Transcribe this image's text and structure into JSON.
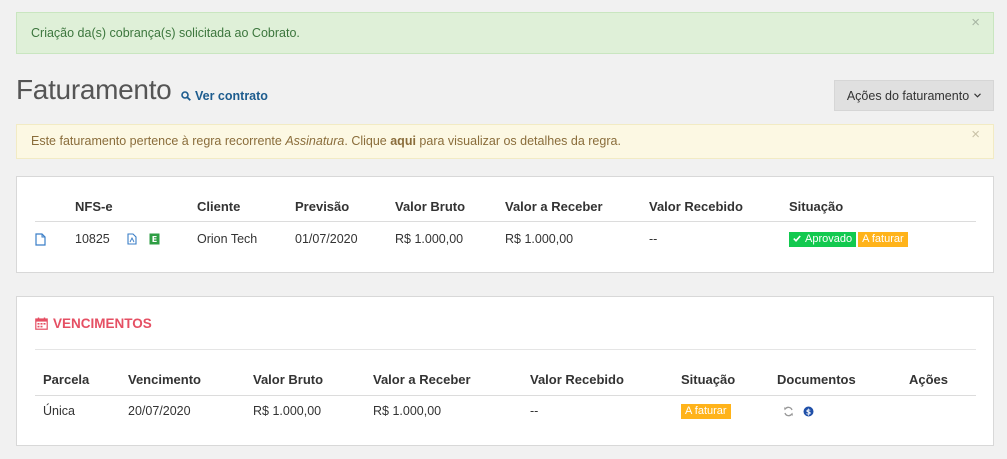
{
  "alert_success": {
    "message": "Criação da(s) cobrança(s) solicitada ao Cobrato.",
    "close": "×"
  },
  "header": {
    "title": "Faturamento",
    "ver_contrato": "Ver contrato",
    "acoes_label": "Ações do faturamento"
  },
  "alert_warning": {
    "text_before": "Este faturamento pertence à regra recorrente ",
    "rule_name": "Assinatura",
    "text_middle": ". Clique ",
    "link": "aqui",
    "text_after": " para visualizar os detalhes da regra.",
    "close": "×"
  },
  "nfse": {
    "columns": [
      "NFS-e",
      "Cliente",
      "Previsão",
      "Valor Bruto",
      "Valor a Receber",
      "Valor Recebido",
      "Situação"
    ],
    "rows": [
      {
        "number": "10825",
        "cliente": "Orion Tech",
        "previsao": "01/07/2020",
        "valor_bruto": "R$ 1.000,00",
        "valor_receber": "R$ 1.000,00",
        "valor_recebido": "--",
        "situacao_1": "Aprovado",
        "situacao_2": "A faturar"
      }
    ]
  },
  "vencimentos": {
    "title": "VENCIMENTOS",
    "columns": [
      "Parcela",
      "Vencimento",
      "Valor Bruto",
      "Valor a Receber",
      "Valor Recebido",
      "Situação",
      "Documentos",
      "Ações"
    ],
    "rows": [
      {
        "parcela": "Única",
        "vencimento": "20/07/2020",
        "valor_bruto": "R$ 1.000,00",
        "valor_receber": "R$ 1.000,00",
        "valor_recebido": "--",
        "situacao": "A faturar"
      }
    ]
  },
  "colors": {
    "success_bg": "#dff0d8",
    "warning_bg": "#fcf8e3",
    "accent_red": "#e54f63",
    "link_blue": "#1d5c8e",
    "badge_green": "#12c94f",
    "badge_orange": "#ffb31a"
  }
}
